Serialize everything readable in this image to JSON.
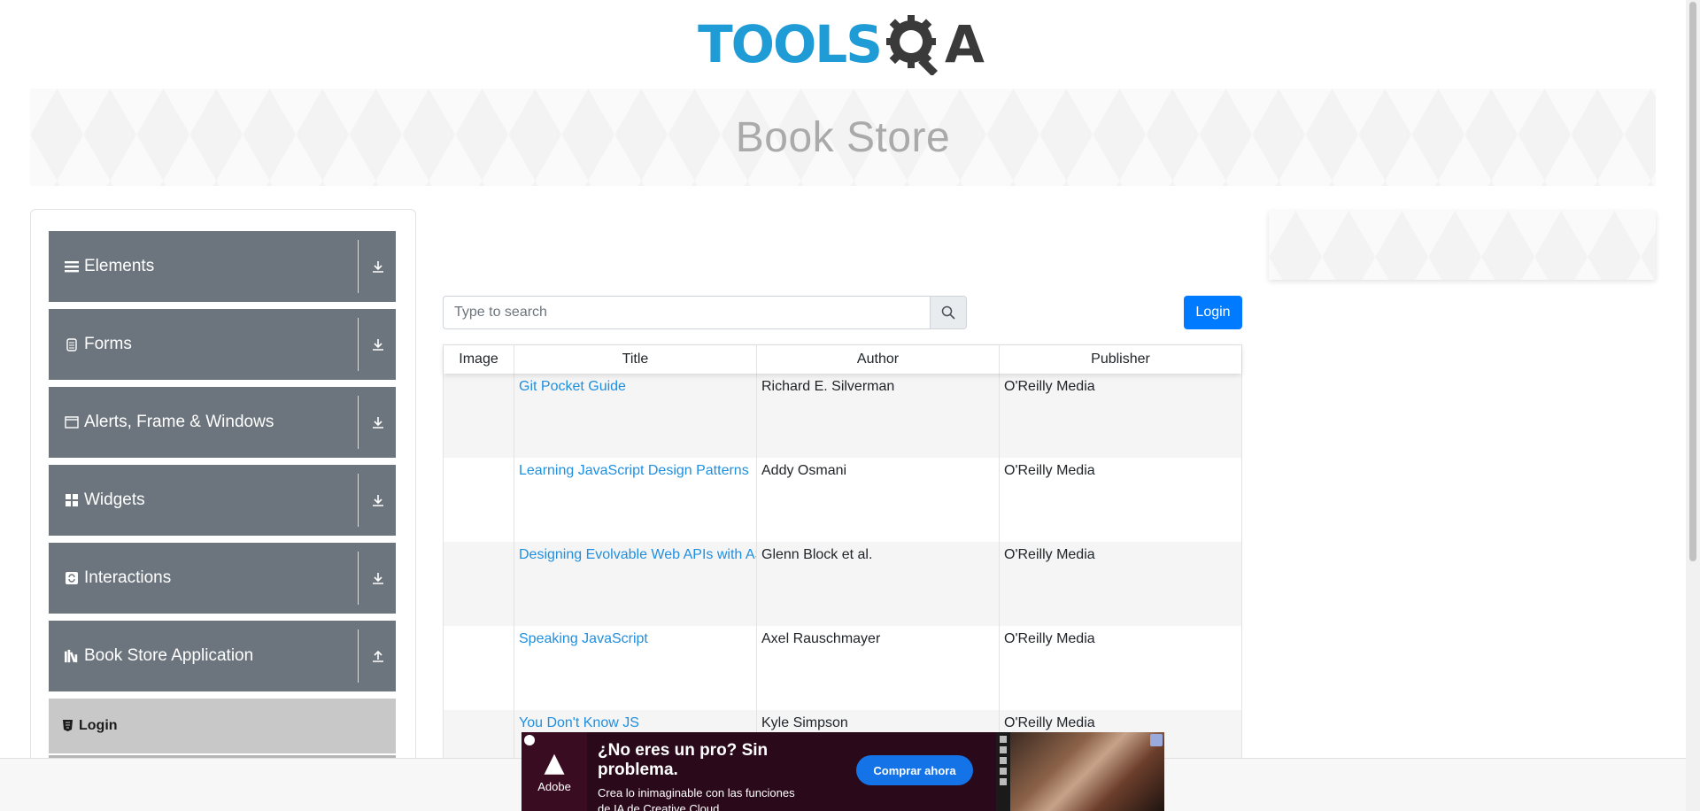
{
  "header": {
    "logo_text": "TOOLS",
    "logo_suffix": "A",
    "page_title": "Book Store"
  },
  "sidebar": {
    "groups": [
      {
        "label": "Elements",
        "icon": "hamburger-icon",
        "expanded": false
      },
      {
        "label": "Forms",
        "icon": "document-icon",
        "expanded": false
      },
      {
        "label": "Alerts, Frame & Windows",
        "icon": "window-icon",
        "expanded": false
      },
      {
        "label": "Widgets",
        "icon": "grid-icon",
        "expanded": false
      },
      {
        "label": "Interactions",
        "icon": "refresh-icon",
        "expanded": false
      },
      {
        "label": "Book Store Application",
        "icon": "books-icon",
        "expanded": true
      }
    ],
    "sub_items": [
      {
        "label": "Login",
        "icon": "html-icon",
        "selected": true
      }
    ]
  },
  "search": {
    "placeholder": "Type to search",
    "value": ""
  },
  "login_button": "Login",
  "table": {
    "columns": [
      "Image",
      "Title",
      "Author",
      "Publisher"
    ],
    "rows": [
      {
        "image": "",
        "title": "Git Pocket Guide",
        "author": "Richard E. Silverman",
        "publisher": "O'Reilly Media"
      },
      {
        "image": "",
        "title": "Learning JavaScript Design Patterns",
        "author": "Addy Osmani",
        "publisher": "O'Reilly Media"
      },
      {
        "image": "",
        "title": "Designing Evolvable Web APIs with ASP.NET",
        "author": "Glenn Block et al.",
        "publisher": "O'Reilly Media"
      },
      {
        "image": "",
        "title": "Speaking JavaScript",
        "author": "Axel Rauschmayer",
        "publisher": "O'Reilly Media"
      },
      {
        "image": "",
        "title": "You Don't Know JS",
        "author": "Kyle Simpson",
        "publisher": "O'Reilly Media"
      }
    ]
  },
  "ad": {
    "brand": "Adobe",
    "headline": "¿No eres un pro? Sin problema.",
    "subtext_1": "Crea lo inimaginable con las funciones",
    "subtext_2": "de IA de Creative Cloud.",
    "cta": "Comprar ahora"
  },
  "colors": {
    "logo_blue": "#1f9bd6",
    "sidebar_group_bg": "#6c757d",
    "primary_button": "#007bff",
    "link": "#1f8fe0"
  }
}
